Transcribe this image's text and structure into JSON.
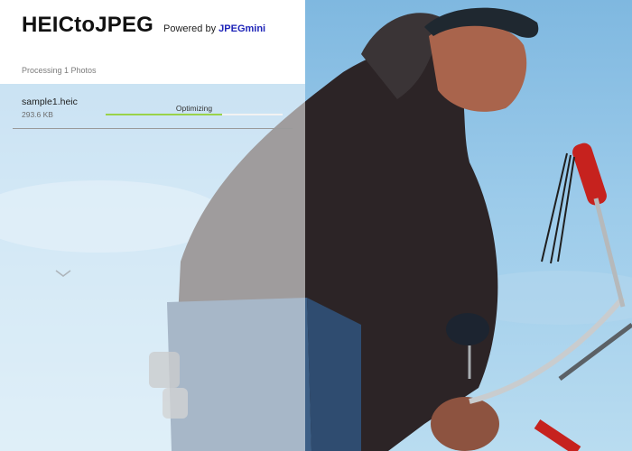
{
  "app": {
    "title": "HEICtoJPEG",
    "powered_prefix": "Powered by",
    "powered_brand": "JPEGmini",
    "brand_color": "#1e24b8"
  },
  "queue": {
    "processing_text": "Processing 1 Photos",
    "files": [
      {
        "name": "sample1.heic",
        "size": "293.6 KB",
        "status": "Optimizing",
        "progress": 0.66,
        "progress_color": "#9ad24a"
      }
    ]
  }
}
